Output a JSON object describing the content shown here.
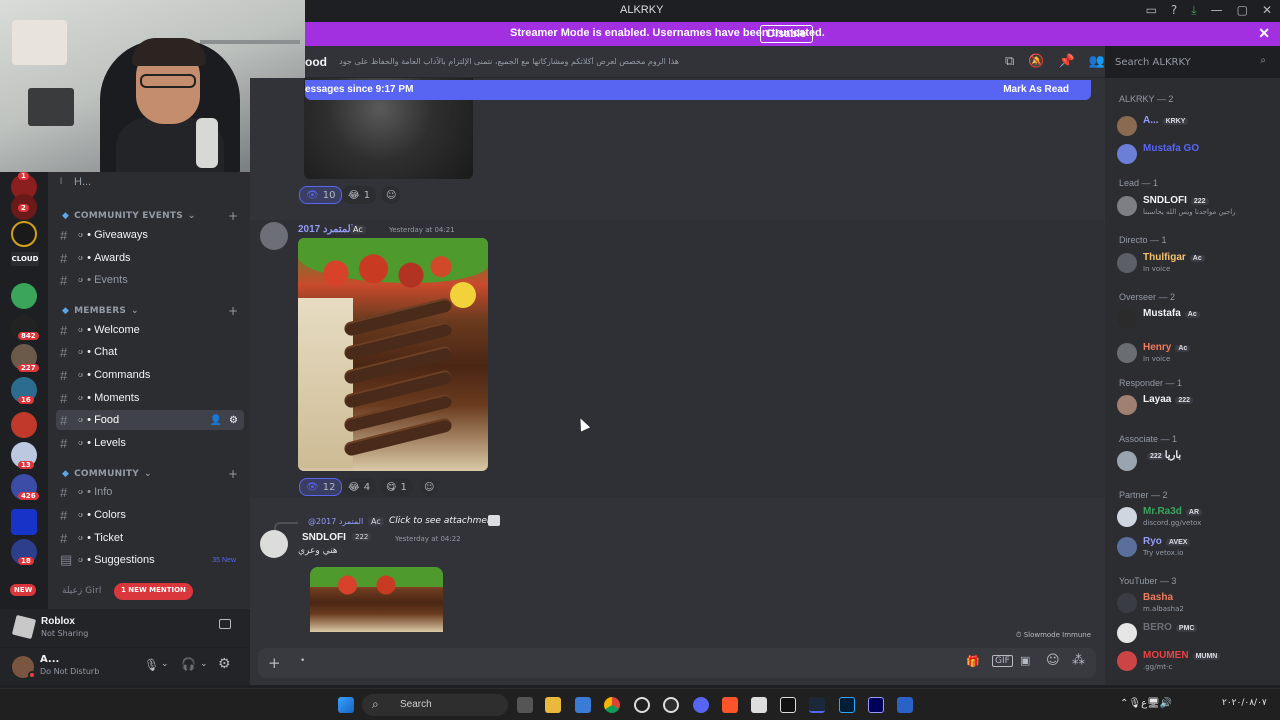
{
  "window": {
    "title": "ALKRKY"
  },
  "banner": {
    "text": "Streamer Mode is enabled. Usernames have been truncated.",
    "button": "Disable"
  },
  "channel_header": {
    "name": "ood",
    "topic": "هذا الروم مخصص لعرض أكلاتكم ومشاركاتها مع الجميع، نتمنى الإلتزام بالآداب العامة والحفاظ على جودة المحتوى.",
    "search_placeholder": "Search ALKRKY"
  },
  "new_messages_bar": {
    "label": "essages since 9:17 PM",
    "action": "Mark As Read"
  },
  "servers": [
    {
      "badge": "1"
    },
    {
      "badge": "2"
    },
    {
      "badge": ""
    },
    {
      "badge": ""
    },
    {
      "badge": ""
    },
    {
      "badge": "842"
    },
    {
      "badge": "227"
    },
    {
      "badge": "16"
    },
    {
      "badge": ""
    },
    {
      "badge": "13"
    },
    {
      "badge": "426"
    },
    {
      "badge": ""
    },
    {
      "badge": "18"
    }
  ],
  "server_rail_labels": {
    "new": "NEW",
    "cloud": "CLOUD"
  },
  "channel_list": {
    "top_item": "H...",
    "categories": [
      {
        "name": "COMMUNITY EVENTS",
        "channels": [
          "Giveaways",
          "Awards",
          "Events"
        ]
      },
      {
        "name": "MEMBERS",
        "channels": [
          "Welcome",
          "Chat",
          "Commands",
          "Moments",
          "Food",
          "Levels"
        ]
      },
      {
        "name": "COMMUNITY",
        "channels": [
          "Info",
          "Colors",
          "Ticket",
          "Suggestions"
        ]
      }
    ],
    "channel_emoji": "ဖ",
    "suggestions_new": "35 New",
    "girl_category": "زعيلة Girl",
    "mention_pill": "1 NEW MENTION"
  },
  "activity": {
    "title": "Roblox",
    "sub": "Not Sharing"
  },
  "user": {
    "name": "A...",
    "status": "Do Not Disturb"
  },
  "messages": [
    {
      "reactions": [
        {
          "emoji": "👁",
          "count": "10"
        },
        {
          "emoji": "😂",
          "count": "1"
        }
      ]
    },
    {
      "author": "المتمرد 2017",
      "tag": "Ac",
      "time": "Yesterday at 04:21",
      "reactions": [
        {
          "emoji": "👁",
          "count": "12"
        },
        {
          "emoji": "😂",
          "count": "4"
        },
        {
          "emoji": "😋",
          "count": "1"
        }
      ]
    },
    {
      "reply_to": "@2017 المتمرد",
      "reply_tag": "Ac",
      "reply_text": "Click to see attachment",
      "author": "SNDLOFI",
      "tag": "222",
      "time": "Yesterday at 04:22",
      "text": "هني وعري"
    }
  ],
  "slowmode": "Slowmode Immune",
  "members": {
    "groups": [
      {
        "role": "ALKRKY — 2",
        "members": [
          {
            "name": "A...",
            "tag": "KRKY",
            "color": "#949cf7",
            "sub": ""
          },
          {
            "name": "Mustafa GO",
            "tag": "",
            "color": "#5865f2",
            "sub": ""
          }
        ]
      },
      {
        "role": "Lead — 1",
        "members": [
          {
            "name": "SNDLOFI",
            "tag": "222",
            "color": "#f2f3f5",
            "sub": "راجين مواجدنا ويس الله يحاسبنا"
          }
        ]
      },
      {
        "role": "Directo — 1",
        "members": [
          {
            "name": "Thulfigar",
            "tag": "Ac",
            "color": "#f5c26b",
            "sub": "In voice"
          }
        ]
      },
      {
        "role": "Overseer — 2",
        "members": [
          {
            "name": "Mustafa",
            "tag": "Ac",
            "color": "#f2f3f5",
            "sub": ""
          },
          {
            "name": "Henry",
            "tag": "Ac",
            "color": "#f27a5c",
            "sub": "In voice"
          }
        ]
      },
      {
        "role": "Responder — 1",
        "members": [
          {
            "name": "Layaa",
            "tag": "222",
            "color": "#f2f3f5",
            "sub": ""
          }
        ]
      },
      {
        "role": "Associate — 1",
        "members": [
          {
            "name": "باريا",
            "tag": "222",
            "color": "#f2f3f5",
            "sub": ""
          }
        ]
      },
      {
        "role": "Partner — 2",
        "members": [
          {
            "name": "Mr.Ra3d",
            "tag": "AR",
            "color": "#3ba55c",
            "sub": "discord.gg/vetox"
          },
          {
            "name": "Ryo",
            "tag": "AVEX",
            "color": "#949cf7",
            "sub": "Try vetox.io"
          }
        ]
      },
      {
        "role": "YouTuber — 3",
        "members": [
          {
            "name": "Basha",
            "tag": "",
            "color": "#f27a5c",
            "sub": "m.albasha2"
          },
          {
            "name": "BERO",
            "tag": "PMC",
            "color": "#6d6f78",
            "sub": ""
          },
          {
            "name": "MOUMEN",
            "tag": "MUMN",
            "color": "#ed4245",
            "sub": ".gg/mt-c"
          }
        ]
      }
    ]
  },
  "taskbar": {
    "search": "Search",
    "clock": "٢٠٢٠/٠٨/٠٧"
  },
  "colors": {
    "blurple": "#5865f2",
    "banner": "#a22fe0",
    "red": "#da373c"
  }
}
